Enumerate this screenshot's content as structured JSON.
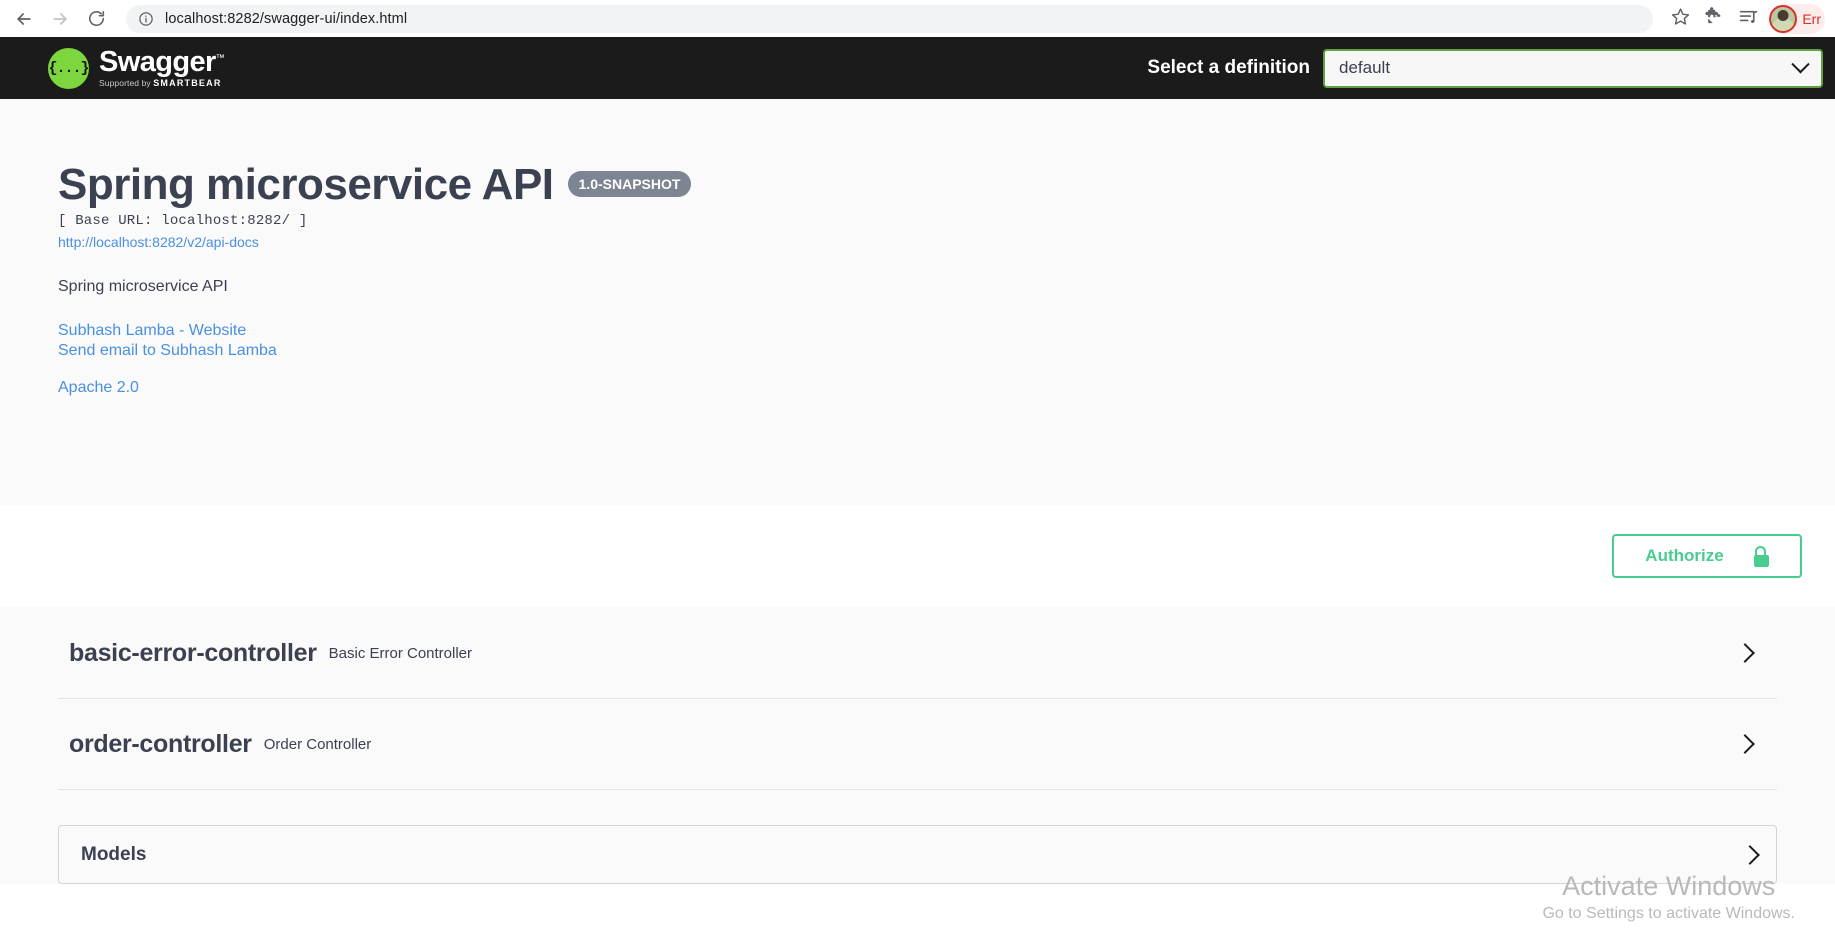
{
  "browser": {
    "back_icon": "arrow-left-icon",
    "forward_icon": "arrow-right-icon",
    "reload_icon": "reload-icon",
    "site_info_icon": "info-circle-icon",
    "url": "localhost:8282/swagger-ui/index.html",
    "bookmark_icon": "star-icon",
    "extensions_icon": "puzzle-piece-icon",
    "media_list_icon": "playlist-icon",
    "profile_label": "Err",
    "profile_icon": "avatar-icon"
  },
  "topbar": {
    "logo_glyph": "{...}",
    "wordmark": "Swagger",
    "trademark": "™",
    "tagline_prefix": "Supported by",
    "tagline_brand": "SMARTBEAR",
    "definition_label": "Select a definition",
    "definition_value": "default",
    "definition_options": [
      "default"
    ],
    "chevron_icon": "chevron-down-icon",
    "accent_green": "#62a03f",
    "logo_green": "#7dd63d",
    "background": "#1b1b1b"
  },
  "info": {
    "title": "Spring microservice API",
    "version_badge": "1.0-SNAPSHOT",
    "base_url": "[ Base URL: localhost:8282/ ]",
    "api_docs_url": "http://localhost:8282/v2/api-docs",
    "description": "Spring microservice API",
    "contact_link": "Subhash Lamba - Website",
    "email_link": "Send email to Subhash Lamba",
    "license_link": "Apache 2.0",
    "link_color": "#4a90e2",
    "badge_color": "#7d8492"
  },
  "auth": {
    "authorize_label": "Authorize",
    "lock_icon": "unlock-icon",
    "accent_color": "#49cc90"
  },
  "tags": [
    {
      "name": "basic-error-controller",
      "description": "Basic Error Controller",
      "expand_icon": "chevron-right-icon"
    },
    {
      "name": "order-controller",
      "description": "Order Controller",
      "expand_icon": "chevron-right-icon"
    }
  ],
  "models": {
    "title": "Models",
    "expand_icon": "chevron-right-icon"
  },
  "watermark": {
    "title": "Activate Windows",
    "subtitle": "Go to Settings to activate Windows."
  }
}
